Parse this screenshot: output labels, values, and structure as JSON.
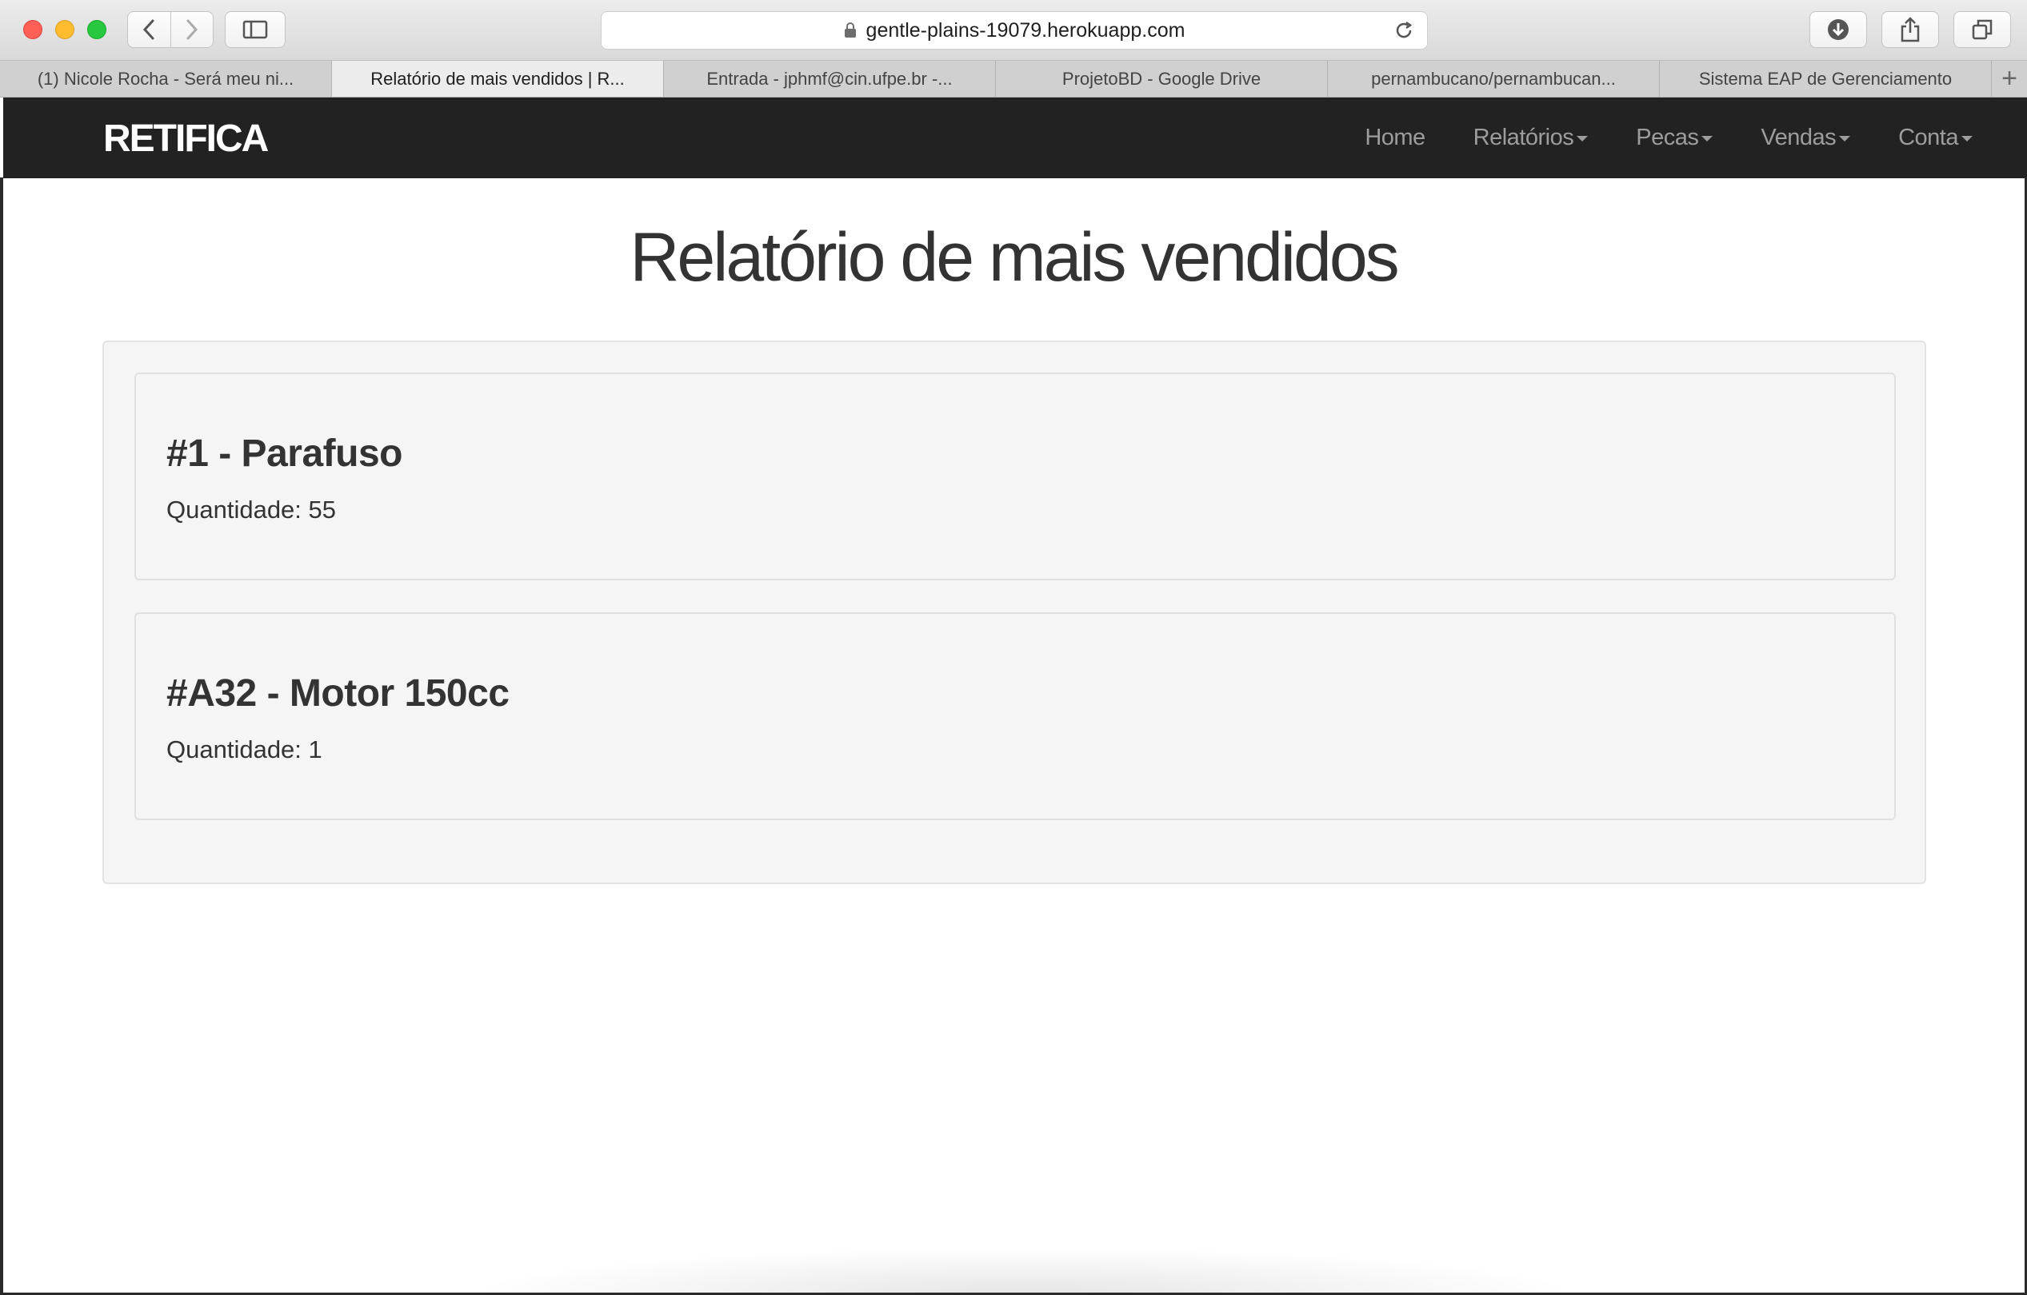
{
  "browser": {
    "url": "gentle-plains-19079.herokuapp.com",
    "tabs": [
      {
        "label": "(1) Nicole Rocha - Será meu ni..."
      },
      {
        "label": "Relatório de mais vendidos | R..."
      },
      {
        "label": "Entrada - jphmf@cin.ufpe.br -..."
      },
      {
        "label": "ProjetoBD - Google Drive"
      },
      {
        "label": "pernambucano/pernambucan..."
      },
      {
        "label": "Sistema EAP de Gerenciamento"
      }
    ],
    "new_tab": "+"
  },
  "navbar": {
    "brand": "RETIFICA",
    "items": [
      {
        "label": "Home"
      },
      {
        "label": "Relatórios"
      },
      {
        "label": "Pecas"
      },
      {
        "label": "Vendas"
      },
      {
        "label": "Conta"
      }
    ]
  },
  "page": {
    "title": "Relatório de mais vendidos",
    "items": [
      {
        "title": "#1 - Parafuso",
        "quantity": "Quantidade: 55"
      },
      {
        "title": "#A32 - Motor 150cc",
        "quantity": "Quantidade: 1"
      }
    ]
  },
  "colors": {
    "navbar_bg": "#222222",
    "nav_text": "#9d9d9d",
    "well_bg": "#f5f5f5",
    "text": "#333333"
  }
}
